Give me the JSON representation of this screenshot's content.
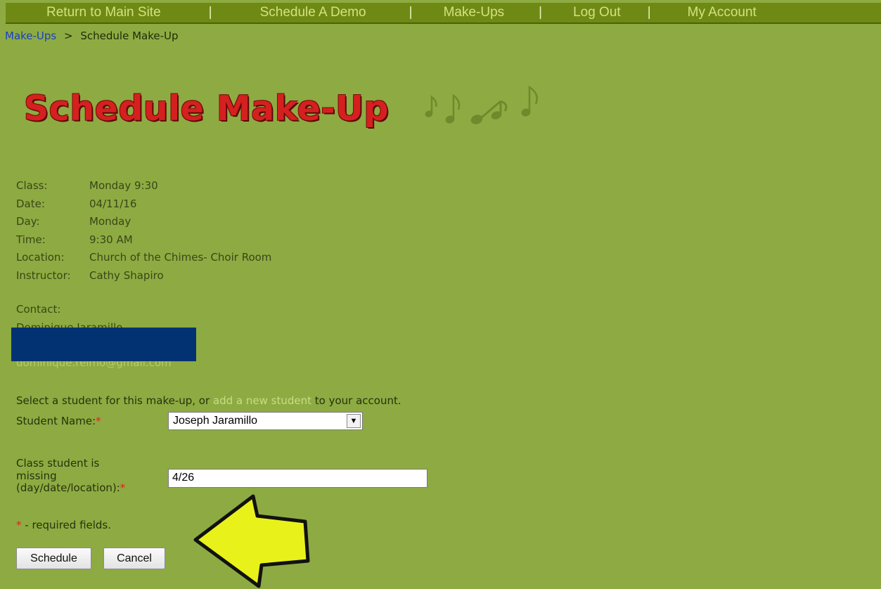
{
  "nav": {
    "items": [
      "Return to Main Site",
      "Schedule A Demo",
      "Make-Ups",
      "Log Out",
      "My Account"
    ],
    "separator": "|"
  },
  "breadcrumb": {
    "link": "Make-Ups",
    "separator": ">",
    "current": "Schedule Make-Up"
  },
  "page_title": "Schedule Make-Up",
  "class_info": {
    "class_label": "Class:",
    "class_value": "Monday 9:30",
    "date_label": "Date:",
    "date_value": "04/11/16",
    "day_label": "Day:",
    "day_value": "Monday",
    "time_label": "Time:",
    "time_value": "9:30 AM",
    "location_label": "Location:",
    "location_value": "Church of the Chimes- Choir Room",
    "instructor_label": "Instructor:",
    "instructor_value": "Cathy Shapiro"
  },
  "contact": {
    "label": "Contact:",
    "name": "Dominique Jaramillo",
    "email": "dominique.reimo@gmail.com"
  },
  "form": {
    "prompt_before": "Select a student for this make-up, or ",
    "prompt_link": "add a new student",
    "prompt_after": " to your account.",
    "student_label": "Student Name:",
    "required_mark": "*",
    "student_selected": "Joseph Jaramillo",
    "missing_label_1": "Class student is",
    "missing_label_2": "missing",
    "missing_label_3": "(day/date/location):",
    "missing_value": "4/26",
    "legend_text": " - required fields."
  },
  "buttons": {
    "schedule": "Schedule",
    "cancel": "Cancel"
  },
  "colors": {
    "page_bg": "#8dab42",
    "nav_bg": "#6f8a14",
    "title_red": "#d52020",
    "redaction": "#033273",
    "arrow_yellow": "#e8f21a"
  }
}
